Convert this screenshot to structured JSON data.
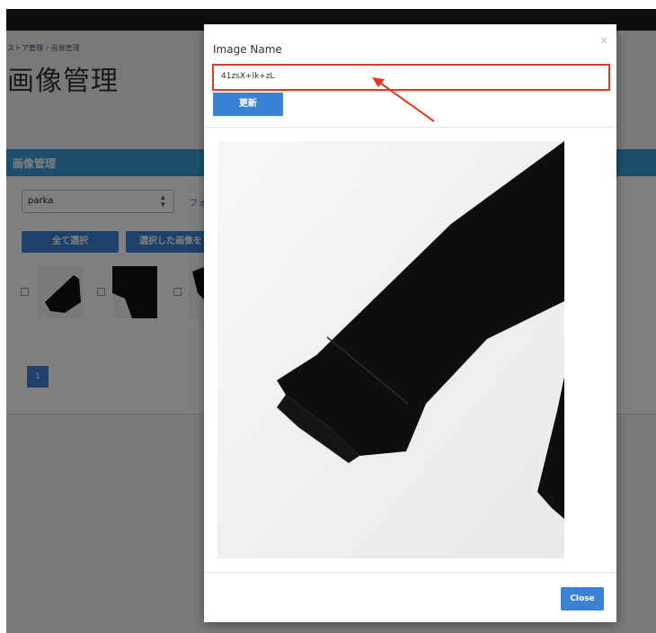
{
  "breadcrumb": {
    "store": "ストア管理",
    "separator": "/",
    "current": "画像管理"
  },
  "page_title": "画像管理",
  "panel": {
    "title": "画像管理",
    "search_value": "parka",
    "folder_link": "フォ",
    "select_all_label": "全て選択",
    "selected_action_label": "選択した画像を",
    "page_number": "1"
  },
  "modal": {
    "label": "Image Name",
    "image_name_value": "41zsX+lk+zL",
    "update_label": "更新",
    "close_label": "Close",
    "close_x": "×"
  },
  "icons": {
    "select_arrow": "select-arrows-icon",
    "dismiss": "close-icon"
  },
  "colors": {
    "accent": "#3b82d6",
    "panel_header": "#3b9fd8",
    "highlight": "#e03a20",
    "overlay": "rgba(0,0,0,0.5)"
  }
}
